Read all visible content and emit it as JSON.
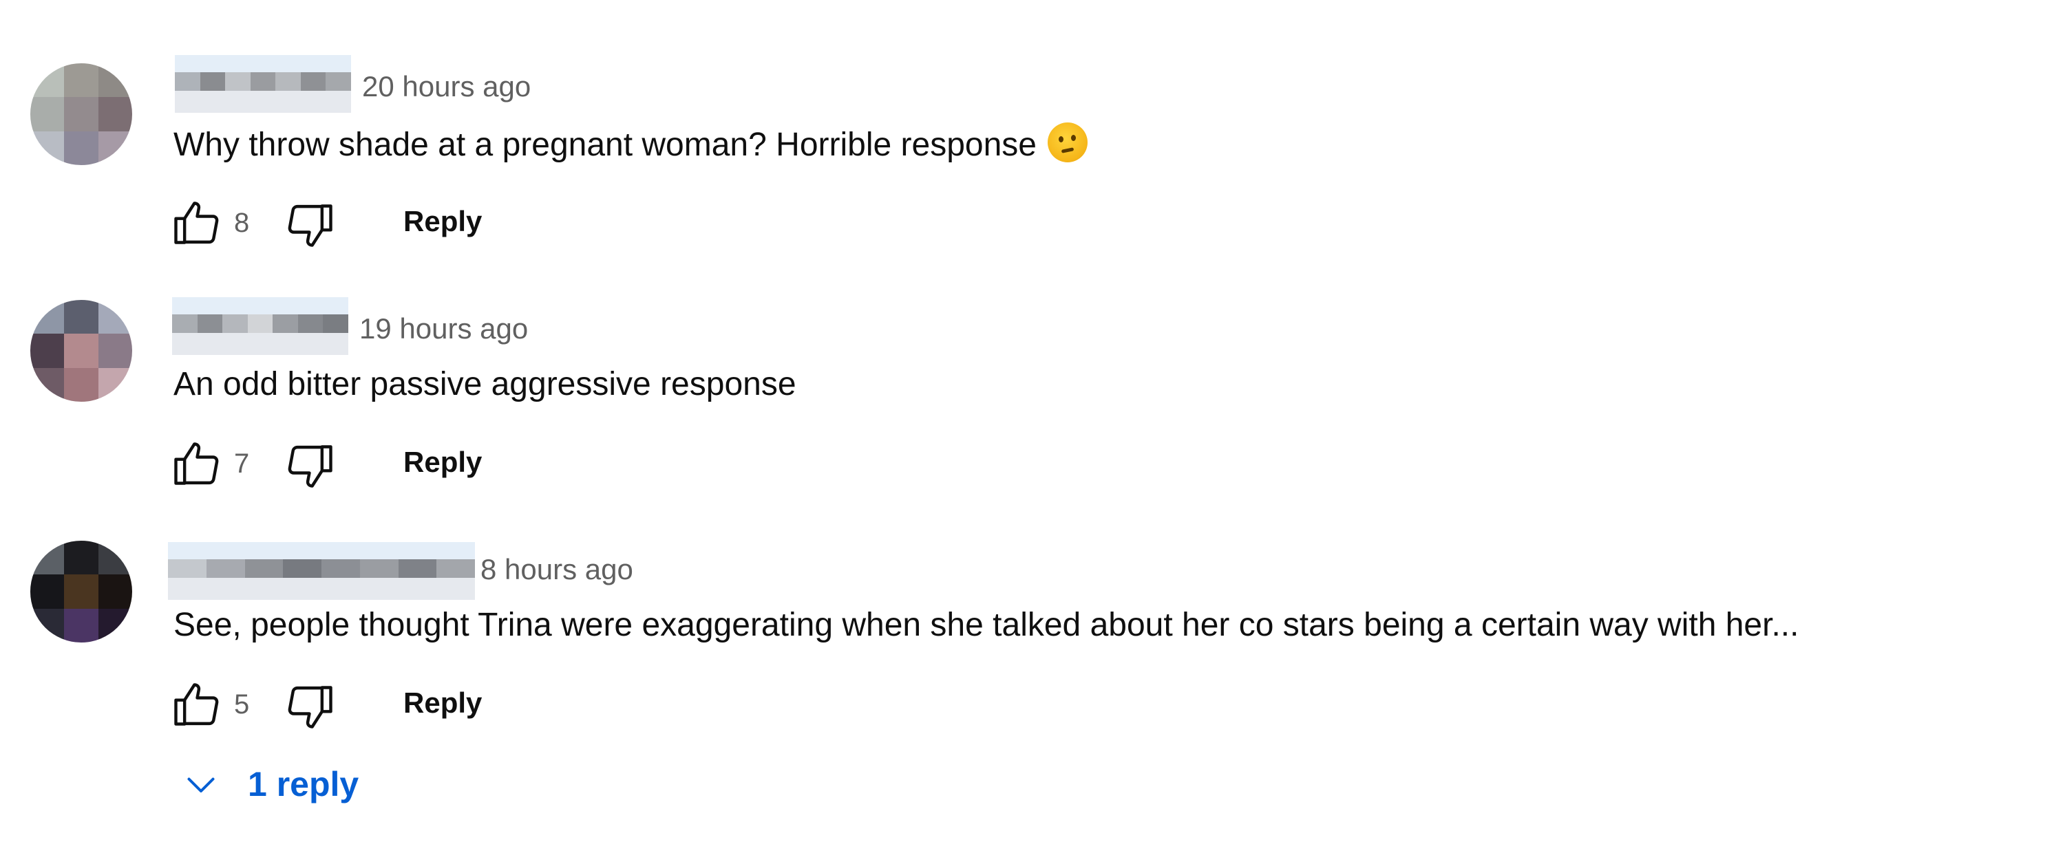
{
  "comments": [
    {
      "time": "20 hours ago",
      "text": "Why throw shade at a pregnant woman? Horrible response",
      "has_emoji": true,
      "emoji_icon": "thinking-face-icon",
      "likes": "8",
      "reply_label": "Reply",
      "avatar_colors": [
        "#b9bfb9",
        "#9d9a94",
        "#8e8a86",
        "#a9adaa",
        "#938b8e",
        "#7c6e73",
        "#b8bcc4",
        "#8c8899",
        "#a69aa6"
      ],
      "name_colors": [
        "#aeb3b9",
        "#8a8c90",
        "#c0c3c7",
        "#9a9ca0",
        "#b6b9bd",
        "#8f9195",
        "#a5a8ac"
      ]
    },
    {
      "time": "19 hours ago",
      "text": "An odd bitter passive aggressive response",
      "has_emoji": false,
      "likes": "7",
      "reply_label": "Reply",
      "avatar_colors": [
        "#8e96a6",
        "#5c5f6e",
        "#a4a9b9",
        "#4d3f4c",
        "#b38a8e",
        "#8a7a88",
        "#6e5b66",
        "#a0767c",
        "#c4a6ad"
      ],
      "name_colors": [
        "#a9adb2",
        "#8c8f94",
        "#b4b7bc",
        "#d2d4d7",
        "#9b9ea3",
        "#86898e",
        "#7a7d82"
      ]
    },
    {
      "time": "8 hours ago",
      "text": "See, people thought Trina were exaggerating when she talked about her co stars being a certain way with her...",
      "has_emoji": false,
      "likes": "5",
      "reply_label": "Reply",
      "avatar_colors": [
        "#5b6066",
        "#1c1c20",
        "#3b3d42",
        "#16161a",
        "#4a3520",
        "#1a1412",
        "#2a2a36",
        "#4b3564",
        "#241a2e"
      ],
      "name_colors": [
        "#c4c8cd",
        "#a7aab0",
        "#8f9297",
        "#777a80",
        "#8c8f95",
        "#9a9da2",
        "#7f8288",
        "#a3a6ab"
      ]
    }
  ],
  "icons": {
    "like": "thumbs-up-icon",
    "dislike": "thumbs-down-icon",
    "chevron": "chevron-down-icon"
  },
  "replies_toggle": {
    "label": "1 reply",
    "color": "#065fd4"
  }
}
